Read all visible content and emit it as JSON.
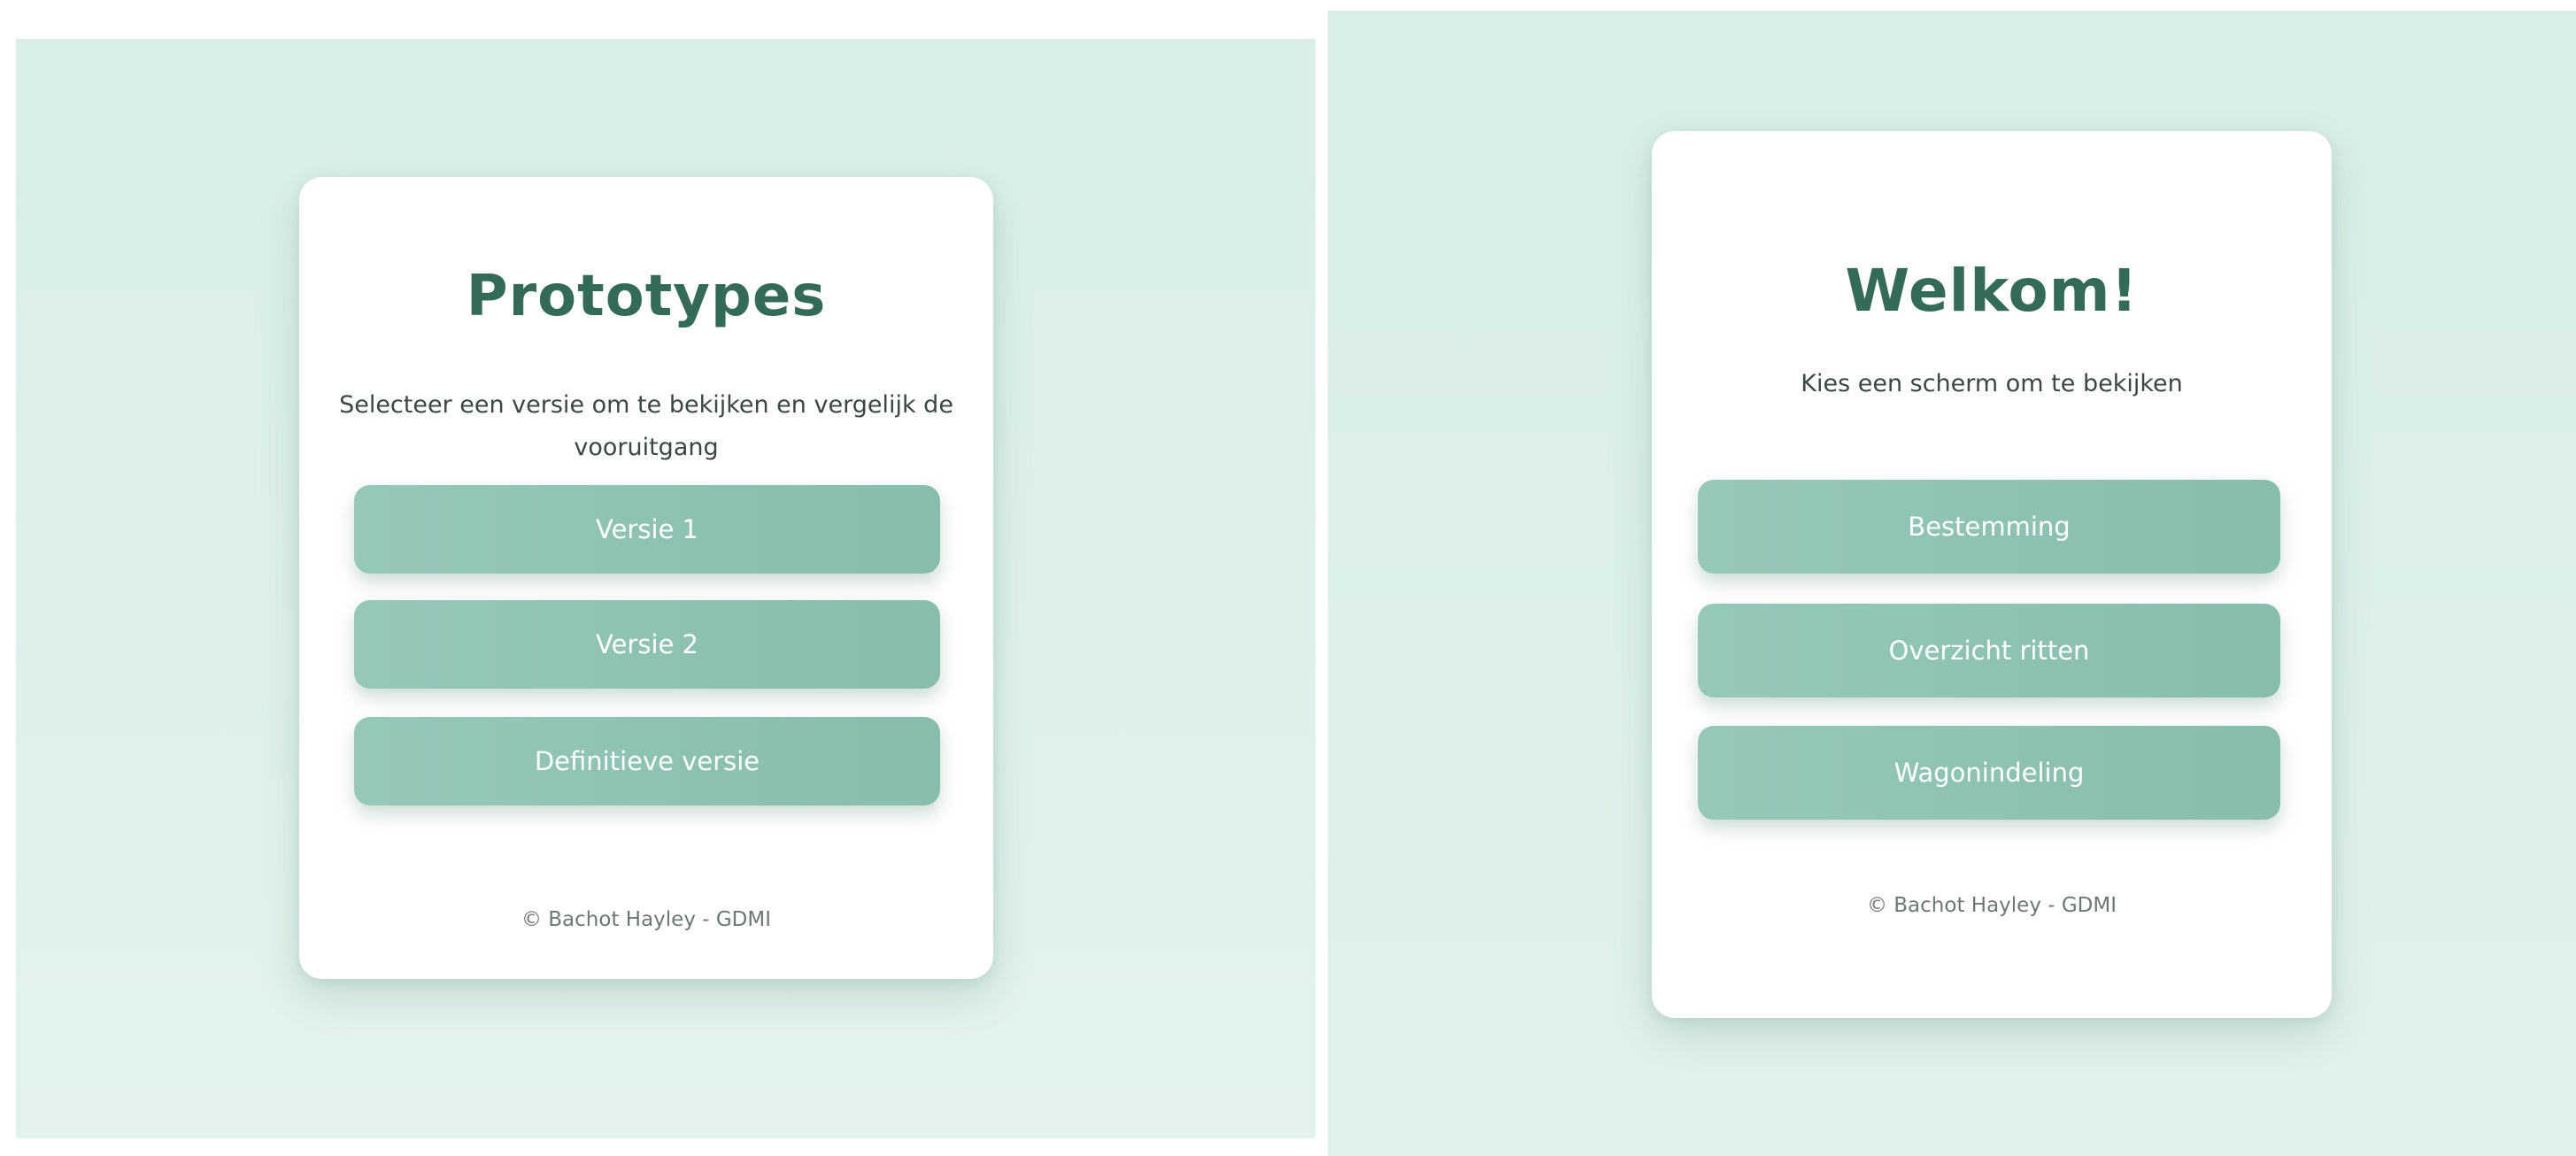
{
  "prototypes_screen": {
    "title": "Prototypes",
    "subtitle": "Selecteer een versie om te bekijken en vergelijk de vooruitgang",
    "buttons": [
      {
        "label": "Versie 1"
      },
      {
        "label": "Versie 2"
      },
      {
        "label": "Definitieve versie"
      }
    ],
    "footer": "© Bachot Hayley - GDMI"
  },
  "welcome_screen": {
    "title": "Welkom!",
    "subtitle": "Kies een scherm om te bekijken",
    "buttons": [
      {
        "label": "Bestemming"
      },
      {
        "label": "Overzicht ritten"
      },
      {
        "label": "Wagonindeling"
      }
    ],
    "footer": "© Bachot Hayley - GDMI"
  },
  "colors": {
    "background": "#dcefe9",
    "card": "#ffffff",
    "title": "#346b58",
    "button": "#8fc3b3",
    "button_text": "#ffffff",
    "subtitle": "#3a4743",
    "footer": "#6d7874"
  }
}
